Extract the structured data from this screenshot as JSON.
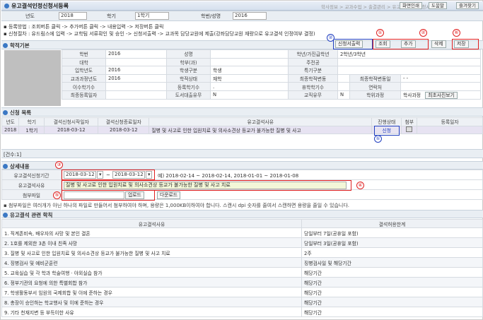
{
  "window": {
    "title": "유고결석인정신청서등록",
    "breadcrumb": "학사정보 > 교과수업 > 출결관리 > 유고결석인정신청서등록",
    "buttons": [
      "화면인쇄",
      "도움말",
      "즐겨찾기"
    ]
  },
  "search": {
    "year_label": "년도",
    "year": "2018",
    "term_label": "학기",
    "term": "1학기",
    "student_label": "학번/성명",
    "student": "2016"
  },
  "instructions": [
    "▪ 등록방법 : 조회버튼 클릭 -> 추가버튼 클릭 -> 내용입력 -> 저장버튼 클릭",
    "▪ 신청절차 : 유드림스에 입력 -> 교학팀 서류확인 및 승인 -> 신청서출력 -> 교과목 담당교원에 제출(강좌담당교원 재량으로 유고결석 인정여부 결정)"
  ],
  "student_section": {
    "title": "학적기본",
    "labels": [
      "학번",
      "성명",
      "학년/가진급학년",
      "대학",
      "학부(과)",
      "주전공",
      "입학년도",
      "학생구분",
      "특기구분",
      "교과과정년도",
      "학적상태",
      "최종학적변동",
      "최종학적변동일",
      "이수학기수",
      "등록학기수",
      "휴학학기수",
      "연락처",
      "최종등록일자",
      "도서대출유무",
      "교직유무",
      "학위과정",
      "최초사진보기"
    ],
    "values": {
      "student_no": "2016",
      "grade": "2학년/3학년",
      "admit_year": "2016",
      "student_type": "학생",
      "curriculum_year": "2016",
      "status": "재학",
      "change_date": "- -",
      "reg_terms": ".",
      "book_loan": "N",
      "teacher": "N",
      "degree": "학사과정"
    }
  },
  "toolbar": {
    "print": "신청서출력",
    "search": "조회",
    "add": "추가",
    "delete": "삭제",
    "save": "저장"
  },
  "apply_list": {
    "title": "신청 목록",
    "headers": [
      "년도",
      "학기",
      "결석신청시작일자",
      "결석신청종료일자",
      "유고결석사유",
      "진행상태",
      "첨부",
      "등록일자"
    ],
    "rows": [
      [
        "2018",
        "1학기",
        "2018-03-12",
        "2018-03-12",
        "질병 및 사고로 인한 입원치료 및 의사소견상 등교가 불가능한 질병 및 사고",
        "신청",
        "",
        ""
      ]
    ],
    "count": "[건수:1]"
  },
  "detail": {
    "title": "상세내용",
    "period_label": "유고결석신청기간",
    "from": "2018-03-12",
    "to": "2018-03-12",
    "example": "예) 2018-02-14 ~ 2018-02-14,    2018-01-01 ~ 2018-01-08",
    "reason_label": "유고결석사유",
    "reason": "질병 및 사고로 인한 입원치료 및 의사소견상 등교가 불가능한 질병 및 사고 치료",
    "file_label": "첨부파일",
    "upload": "업로드",
    "download": "다운로드",
    "note": "▪ 첨부파일은 여러개가 아닌 하나의 파일로 만들어서 첨부하여야 하며, 용량은 1,000KB이하여야 합니다. 스캔시 dpi 숫자를 줄여서 스캔하면 용량을 줄일 수 있습니다."
  },
  "reasons": {
    "title": "유고결석 관련 학칙",
    "headers": [
      "유고결석사유",
      "결석허용한계"
    ],
    "rows": [
      [
        "1. 직계존비속, 배우자의 사망 및 본인 결혼",
        "당일부터 7일(공휴일 포함)"
      ],
      [
        "2. 1호를 제외한 3촌 이내 친족 사망",
        "당일부터 3일(공휴일 포함)"
      ],
      [
        "3. 질병 및 사고로 인한 입원치료 및 의사소견상  등교가 불가능한 질병 및 사고 치료",
        "2주"
      ],
      [
        "4. 징병검사 및 예비군훈련",
        "징병검사일 및 해당기간"
      ],
      [
        "5. 교육실습 및 각 학과 학술여행 · 야외실습 참가",
        "해당기간"
      ],
      [
        "6. 정부기관의 요청에 의한 특별회합 참가",
        "해당기간"
      ],
      [
        "7. 학생활동부서 임원의 국제회합 및 이에 준하는 경우",
        "해당기간"
      ],
      [
        "8. 총장이 승인하는 학교행사 및 이에 준하는 경우",
        "해당기간"
      ],
      [
        "9. 기타 천재지변 등 부득이한 사유",
        "해당기간"
      ]
    ]
  },
  "callouts": [
    "①",
    "②",
    "③",
    "④",
    "⑤",
    "⑥",
    "①"
  ],
  "colors": {
    "highlight": "#e02020",
    "callout_blue": "#2240c0",
    "row_selected": "#e7e3f2"
  }
}
